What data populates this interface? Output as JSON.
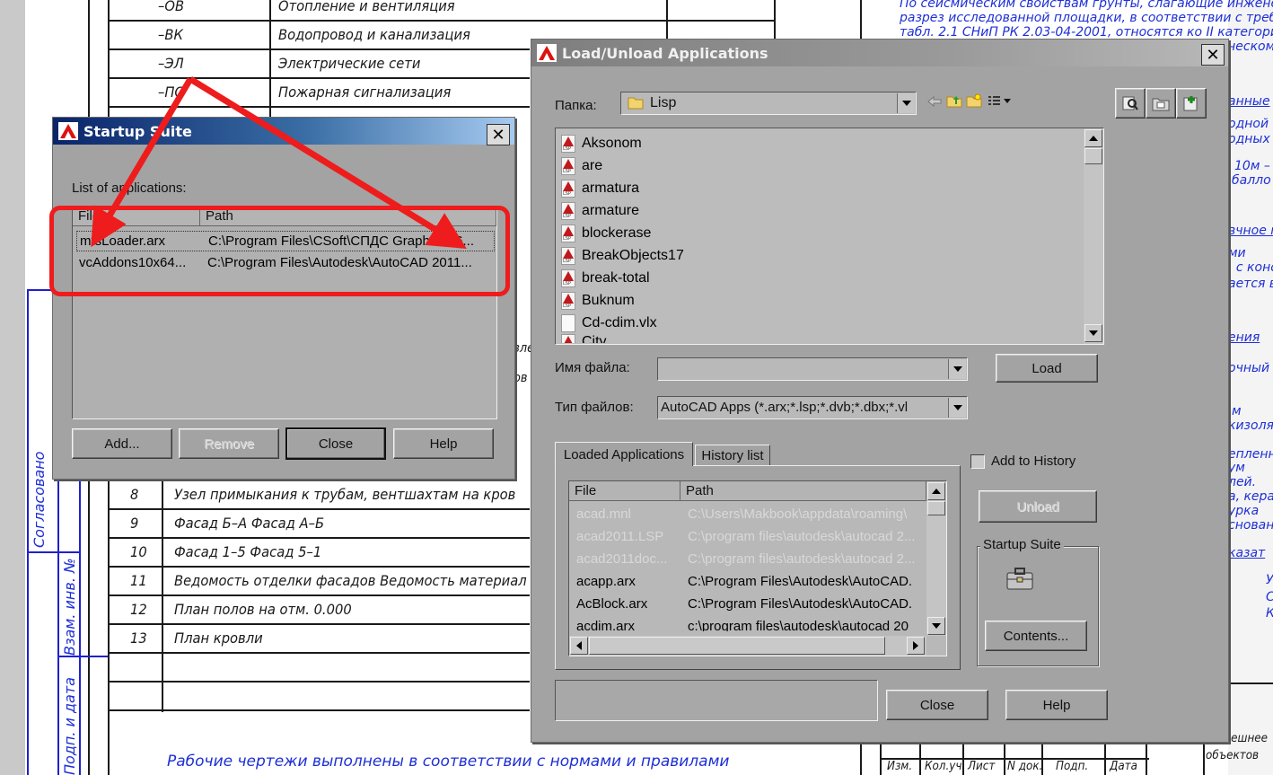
{
  "cad": {
    "rows_top": [
      {
        "code": "–ОВ",
        "name": "Отопление и вентиляция"
      },
      {
        "code": "–ВК",
        "name": "Водопровод и канализация"
      },
      {
        "code": "–ЭЛ",
        "name": "Электрические сети"
      },
      {
        "code": "–ПС",
        "name": "Пожарная сигнализация"
      }
    ],
    "rows_bottom": [
      {
        "num": "8",
        "name": "Узел примыкания к трубам, вентшахтам на кров"
      },
      {
        "num": "9",
        "name": "Фасад Б–А Фасад А–Б"
      },
      {
        "num": "10",
        "name": "Фасад 1–5 Фасад 5–1"
      },
      {
        "num": "11",
        "name": "Ведомость отделки фасадов Ведомость материал"
      },
      {
        "num": "12",
        "name": "План полов на отм. 0.000"
      },
      {
        "num": "13",
        "name": "План кровли"
      }
    ],
    "footer_note": "Рабочие чертежи выполнены в соответствии с нормами и правилами",
    "side_labels": [
      "Согласовано",
      "Взам. инв. №",
      "Подп. и дата"
    ],
    "right_notes": [
      "По сейсмическим свойствам грунты, слагающие инжене",
      "разрез исследованной площадки, в соответствии с треб",
      "табл. 2.1 СНиП РК 2.03-04-2001, относятся ко II категори",
      "ческому"
    ],
    "right_fragments": [
      "анные",
      "одной",
      "одных х",
      "о 10м –",
      "балло",
      "вчное п",
      "ми",
      ", с конс",
      "ается в",
      "ения",
      "очный",
      "м",
      "кизоля",
      "епленны",
      "ум",
      "лей.",
      "а, кера",
      "урка",
      "снован",
      "казат",
      "У",
      "С",
      "К"
    ],
    "stamp_cols": [
      "Изм.",
      "Кол.уч.",
      "Лист",
      "N док.",
      "Подп.",
      "Дата"
    ],
    "stamp_side": [
      "онешнее",
      "объектов"
    ],
    "stray_text": [
      "зле",
      "ов"
    ]
  },
  "startup_suite": {
    "title": "Startup Suite",
    "list_label": "List of applications:",
    "columns": [
      "File",
      "Path"
    ],
    "rows": [
      {
        "file": "mtsLoader.arx",
        "path": "C:\\Program Files\\CSoft\\СПДС GraphiCS 6..."
      },
      {
        "file": "vcAddons10x64...",
        "path": "C:\\Program Files\\Autodesk\\AutoCAD 2011..."
      }
    ],
    "buttons": {
      "add": "Add...",
      "remove": "Remove",
      "close": "Close",
      "help": "Help"
    }
  },
  "load_dialog": {
    "title": "Load/Unload Applications",
    "folder_label": "Папка:",
    "folder_value": "Lisp",
    "files": [
      "Aksonom",
      "are",
      "armatura",
      "armature",
      "blockerase",
      "BreakObjects17",
      "break-total",
      "Buknum",
      "Cd-cdim.vlx",
      "City"
    ],
    "filename_label": "Имя файла:",
    "filename_value": "",
    "filetype_label": "Тип файлов:",
    "filetype_value": "AutoCAD Apps (*.arx;*.lsp;*.dvb;*.dbx;*.vl",
    "load_button": "Load",
    "tabs": [
      "Loaded Applications",
      "History list"
    ],
    "add_to_history": "Add to History",
    "columns": [
      "File",
      "Path"
    ],
    "loaded": [
      {
        "file": "acad.mnl",
        "path": "C:\\Users\\Makbook\\appdata\\roaming\\",
        "dim": true
      },
      {
        "file": "acad2011.LSP",
        "path": "C:\\program files\\autodesk\\autocad 2...",
        "dim": true
      },
      {
        "file": "acad2011doc...",
        "path": "C:\\program files\\autodesk\\autocad 2...",
        "dim": true
      },
      {
        "file": "acapp.arx",
        "path": "C:\\Program Files\\Autodesk\\AutoCAD.",
        "dim": false
      },
      {
        "file": "AcBlock.arx",
        "path": "C:\\Program Files\\Autodesk\\AutoCAD.",
        "dim": false
      },
      {
        "file": "acdim.arx",
        "path": "c:\\program files\\autodesk\\autocad 20",
        "dim": false
      }
    ],
    "unload_button": "Unload",
    "startup_group": "Startup Suite",
    "contents_button": "Contents...",
    "close_button": "Close",
    "help_button": "Help",
    "status": ""
  },
  "colors": {
    "dialog_bg": "#a3a3a3",
    "title_gradient_start": "#0a246a",
    "title_gradient_end": "#a6caf0",
    "title_inactive_gray": "#808080",
    "annotation_red": "#ee1c1c",
    "cad_blue": "#1e2fd6"
  },
  "icons": [
    "autocad-app-icon",
    "close-icon",
    "folder-icon",
    "back-icon",
    "up-folder-icon",
    "new-folder-icon",
    "view-menu-icon",
    "find-icon",
    "add-to-suite-icon",
    "lisp-file-icon",
    "briefcase-icon"
  ]
}
